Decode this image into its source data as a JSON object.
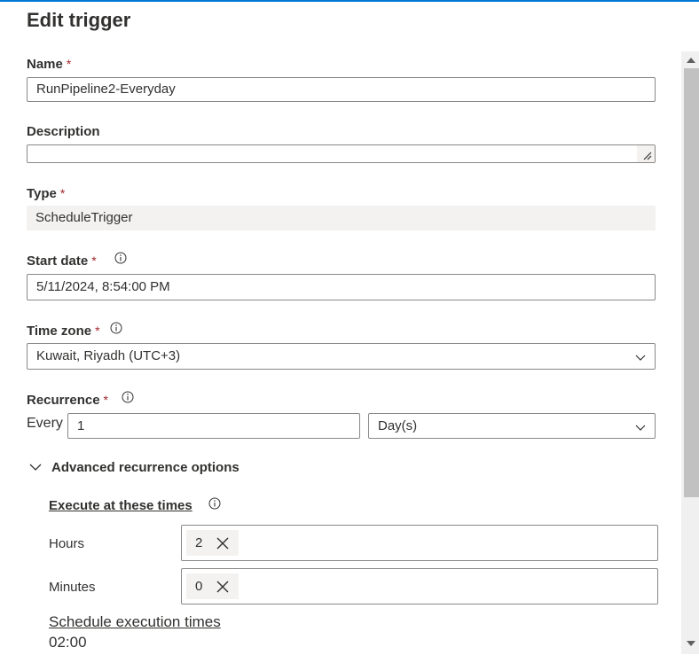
{
  "panel": {
    "title": "Edit trigger"
  },
  "name": {
    "label": "Name",
    "required_mark": "*",
    "value": "RunPipeline2-Everyday"
  },
  "description": {
    "label": "Description",
    "value": ""
  },
  "type": {
    "label": "Type",
    "required_mark": "*",
    "value": "ScheduleTrigger"
  },
  "start_date": {
    "label": "Start date",
    "required_mark": "*",
    "value": "5/11/2024, 8:54:00 PM"
  },
  "time_zone": {
    "label": "Time zone",
    "required_mark": "*",
    "value": "Kuwait, Riyadh (UTC+3)"
  },
  "recurrence": {
    "label": "Recurrence",
    "required_mark": "*",
    "every_label": "Every",
    "interval_value": "1",
    "unit_value": "Day(s)"
  },
  "advanced": {
    "toggle_label": "Advanced recurrence options",
    "expanded": true,
    "execute_label": "Execute at these times",
    "hours": {
      "label": "Hours",
      "tags": [
        "2"
      ]
    },
    "minutes": {
      "label": "Minutes",
      "tags": [
        "0"
      ]
    },
    "schedule_link": "Schedule execution times",
    "schedule_times": [
      "02:00"
    ]
  },
  "icons": {
    "info": "info-icon",
    "chevron": "chevron-down-icon",
    "remove": "close-icon",
    "resize": "resize-grip-icon"
  },
  "colors": {
    "accent": "#0078d4",
    "required": "#a4262c",
    "text": "#323130",
    "border": "#8a8886",
    "readonly_bg": "#f3f2f1"
  }
}
